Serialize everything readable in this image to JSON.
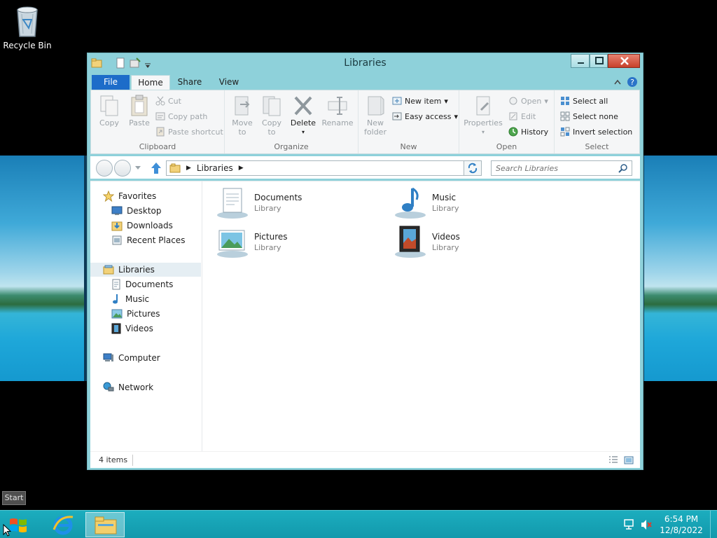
{
  "desktop": {
    "recycle_bin_label": "Recycle Bin",
    "start_tooltip": "Start"
  },
  "window": {
    "title": "Libraries",
    "tabs": {
      "file": "File",
      "home": "Home",
      "share": "Share",
      "view": "View"
    },
    "ribbon": {
      "clipboard": {
        "label": "Clipboard",
        "copy": "Copy",
        "paste": "Paste",
        "cut": "Cut",
        "copy_path": "Copy path",
        "paste_shortcut": "Paste shortcut"
      },
      "organize": {
        "label": "Organize",
        "move_to": "Move to",
        "copy_to": "Copy to",
        "delete": "Delete",
        "rename": "Rename"
      },
      "new": {
        "label": "New",
        "new_folder": "New folder",
        "new_item": "New item",
        "easy_access": "Easy access"
      },
      "open": {
        "label": "Open",
        "properties": "Properties",
        "open": "Open",
        "edit": "Edit",
        "history": "History"
      },
      "select": {
        "label": "Select",
        "select_all": "Select all",
        "select_none": "Select none",
        "invert_selection": "Invert selection"
      }
    },
    "address": {
      "path": "Libraries",
      "search_placeholder": "Search Libraries"
    },
    "nav_pane": {
      "favorites": "Favorites",
      "desktop": "Desktop",
      "downloads": "Downloads",
      "recent_places": "Recent Places",
      "libraries": "Libraries",
      "documents": "Documents",
      "music": "Music",
      "pictures": "Pictures",
      "videos": "Videos",
      "computer": "Computer",
      "network": "Network"
    },
    "libraries": [
      {
        "name": "Documents",
        "type": "Library"
      },
      {
        "name": "Music",
        "type": "Library"
      },
      {
        "name": "Pictures",
        "type": "Library"
      },
      {
        "name": "Videos",
        "type": "Library"
      }
    ],
    "status": {
      "item_count": "4 items"
    }
  },
  "taskbar": {
    "time": "6:54 PM",
    "date": "12/8/2022"
  },
  "colors": {
    "window_frame": "#8ed1da",
    "file_tab": "#1d6cc9",
    "taskbar": "#1aa7b9",
    "close_button": "#c7412b"
  }
}
